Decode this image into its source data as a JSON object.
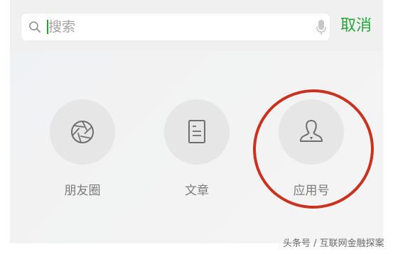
{
  "search": {
    "text": "搜索",
    "icon": "search-icon",
    "mic_icon": "microphone-icon"
  },
  "header": {
    "cancel_label": "取消",
    "accent_color": "#27a53a"
  },
  "items": [
    {
      "label": "朋友圈",
      "icon": "moments-aperture-icon"
    },
    {
      "label": "文章",
      "icon": "article-icon"
    },
    {
      "label": "应用号",
      "icon": "person-icon"
    }
  ],
  "annotation": {
    "highlight_color": "#c8321f"
  },
  "watermark": {
    "text": "头条号 / 互联网金融探案"
  }
}
